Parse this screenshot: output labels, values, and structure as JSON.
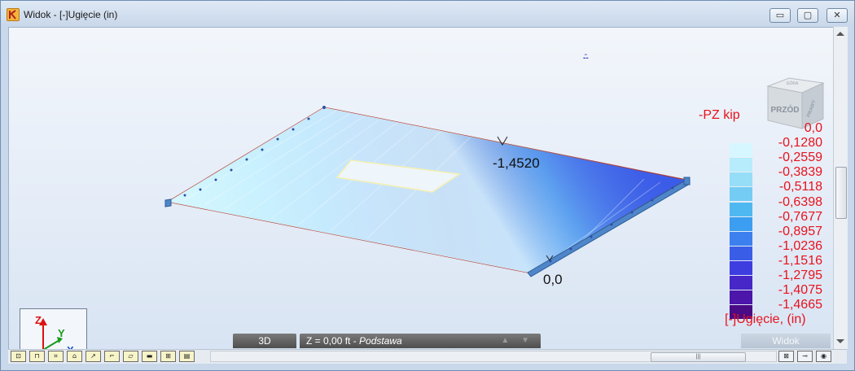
{
  "window": {
    "title": "Widok - [-]Ugięcie (in)",
    "buttons": {
      "minimize": "▭",
      "maximize": "▢",
      "close": "✕"
    }
  },
  "viewport": {
    "top_marker": "-̄-",
    "max_label": "-1,4520",
    "zero_label": "0,0",
    "nav_cube": {
      "front": "PRZÓD",
      "right": "PRAWY",
      "top": "GÓRA"
    },
    "axes": {
      "z": "Z",
      "y": "Y",
      "x": "X"
    }
  },
  "legend": {
    "title": "-PZ kip",
    "footer": "[-]Ugięcie, (in)",
    "entries": [
      {
        "value": "0,0",
        "color": ""
      },
      {
        "value": "-0,1280",
        "color": "#d6f7ff"
      },
      {
        "value": "-0,2559",
        "color": "#b6ecfb"
      },
      {
        "value": "-0,3839",
        "color": "#96ddf7"
      },
      {
        "value": "-0,5118",
        "color": "#74ccf4"
      },
      {
        "value": "-0,6398",
        "color": "#4fb8f0"
      },
      {
        "value": "-0,7677",
        "color": "#3c9ef0"
      },
      {
        "value": "-0,8957",
        "color": "#3b80ee"
      },
      {
        "value": "-1,0236",
        "color": "#3a5de8"
      },
      {
        "value": "-1,1516",
        "color": "#3d3de0"
      },
      {
        "value": "-1,2795",
        "color": "#4727c7"
      },
      {
        "value": "-1,4075",
        "color": "#4b16a9"
      },
      {
        "value": "-1,4665",
        "color": "#4a0b86"
      }
    ]
  },
  "status": {
    "mode": "3D",
    "level": "Z = 0,00 ft - ",
    "story": "Podstawa",
    "nav_arrows": "▲ ▼",
    "view": "Widok"
  },
  "toolbar": {
    "buttons": [
      {
        "name": "tool-1-icon",
        "glyph": "⊡"
      },
      {
        "name": "tool-2-icon",
        "glyph": "⊓"
      },
      {
        "name": "tool-3-icon",
        "glyph": "⌗"
      },
      {
        "name": "tool-4-icon",
        "glyph": "⌂"
      },
      {
        "name": "tool-5-icon",
        "glyph": "↗"
      },
      {
        "name": "tool-6-icon",
        "glyph": "⌐"
      },
      {
        "name": "tool-7-icon",
        "glyph": "▱"
      },
      {
        "name": "tool-8-icon",
        "glyph": "▬"
      },
      {
        "name": "tool-9-icon",
        "glyph": "⊞"
      },
      {
        "name": "tool-10-icon",
        "glyph": "▤"
      }
    ],
    "right_buttons": [
      {
        "name": "tool-11-icon",
        "glyph": "⊠"
      },
      {
        "name": "tool-12-icon",
        "glyph": "⊸"
      },
      {
        "name": "tool-13-icon",
        "glyph": "◉"
      }
    ],
    "scroll_thumb": "|||"
  }
}
